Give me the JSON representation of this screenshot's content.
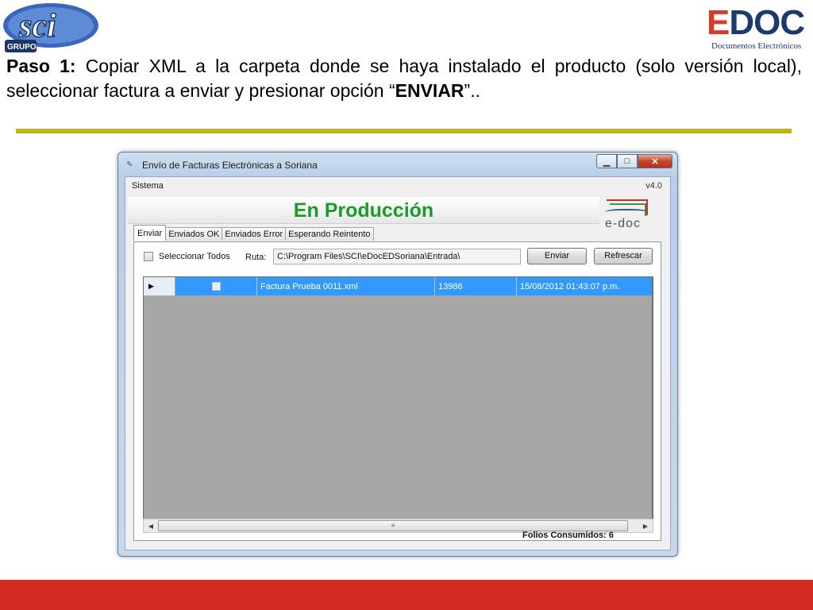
{
  "slide": {
    "step_label": "Paso 1:",
    "step_text_1": " Copiar XML a la carpeta donde se haya instalado el producto (solo versión local), seleccionar factura a enviar y presionar opción “",
    "step_keyword": "ENVIAR",
    "step_text_2": "”..",
    "logo_left": "sci",
    "logo_left_sub": "GRUPO",
    "logo_right": "EDOC",
    "logo_right_sub": "Documentos Electrónicos",
    "colors": {
      "rule": "#b8b81a",
      "footer": "#d42a21",
      "banner_text": "#1d9a2b",
      "row_selected": "#3399ff"
    }
  },
  "window": {
    "title": "Envío de Facturas Electrónicas a Soriana",
    "controls": [
      "minimize-icon",
      "maximize-icon",
      "close-icon"
    ]
  },
  "menu": {
    "sistema": "Sistema",
    "version": "v4.0"
  },
  "banner": {
    "text": "En Producción",
    "logo_text": "e-doc"
  },
  "tabs": [
    "Enviar",
    "Enviados OK",
    "Enviados Error",
    "Esperando Reintento"
  ],
  "toolbar": {
    "select_all": "Seleccionar Todos",
    "ruta_label": "Ruta:",
    "ruta_value": "C:\\Program Files\\SCI\\eDocEDSoriana\\Entrada\\",
    "enviar": "Enviar",
    "refrescar": "Refrescar"
  },
  "grid": {
    "rows": [
      {
        "file": "Factura Prueba 0011.xml",
        "size": "13986",
        "date": "15/08/2012 01:43:07 p.m."
      }
    ]
  },
  "status": {
    "folios": "Folios Consumidos: 6"
  }
}
